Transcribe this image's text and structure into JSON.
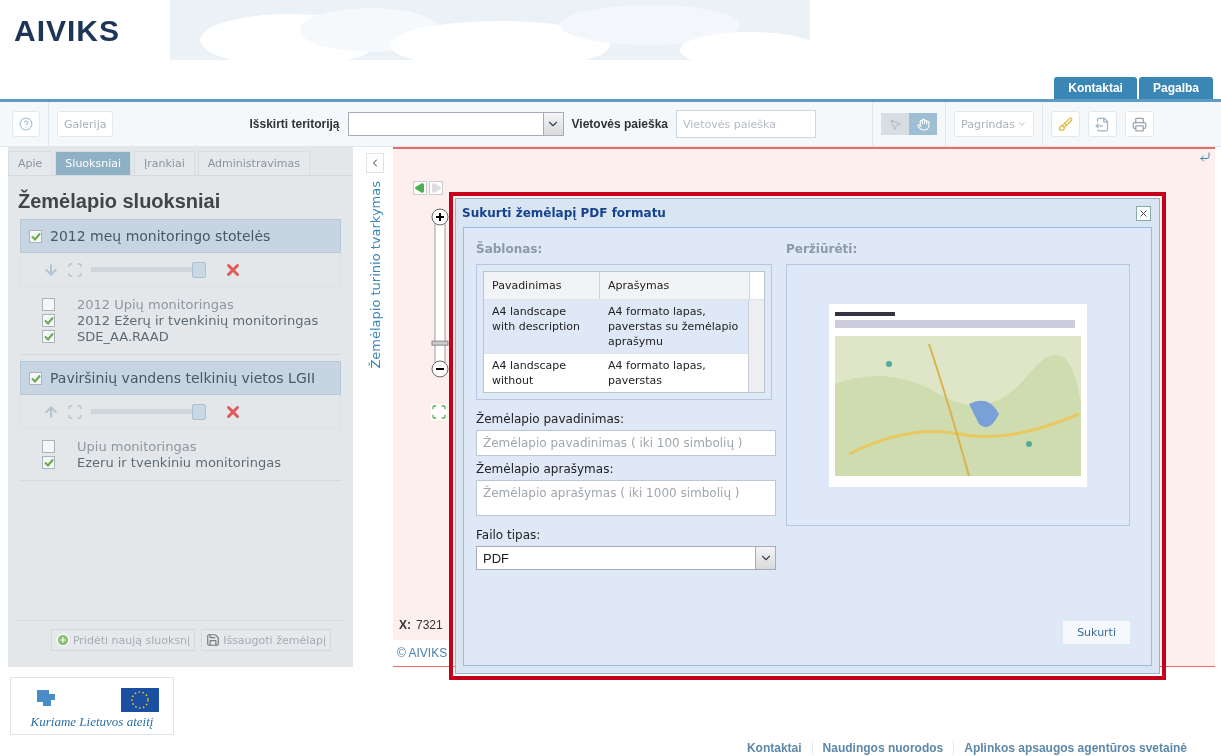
{
  "header": {
    "logo": "AIVIKS",
    "links": [
      "Kontaktai",
      "Pagalba"
    ]
  },
  "toolbar": {
    "gallery_button": "Galerija",
    "territory_label": "Išskirti teritoriją",
    "search_label": "Vietovės paieška",
    "search_field": {
      "placeholder": "Vietovės paieška"
    },
    "tools": [
      {
        "kind": "pointer",
        "selected": false
      },
      {
        "kind": "hand",
        "selected": true
      }
    ],
    "basemap_button": "Pagrindas",
    "actions": [
      {
        "kind": "clear"
      },
      {
        "kind": "export"
      },
      {
        "kind": "print"
      }
    ]
  },
  "side_panel": {
    "tabs": [
      {
        "label": "Apie",
        "selected": false
      },
      {
        "label": "Sluoksniai",
        "selected": true
      },
      {
        "label": "Įrankiai",
        "selected": false
      },
      {
        "label": "Administravimas",
        "selected": false
      }
    ],
    "title": "Žemėlapio sluoksniai",
    "groups": [
      {
        "name": "2012 meų monitoringo stotelės",
        "checked": true,
        "kind": "down",
        "level": 1,
        "layers": [
          {
            "name": "2012 Upių monitoringas",
            "checked": false
          },
          {
            "name": "2012 Ežerų ir tvenkinių monitoringas",
            "checked": true
          },
          {
            "name": "SDE_AA.RAAD",
            "checked": true
          }
        ]
      },
      {
        "name": "Paviršinių vandens telkinių vietos LGII",
        "checked": true,
        "kind": "up",
        "level": 1,
        "layers": [
          {
            "name": "Upiu monitoringas",
            "checked": false
          },
          {
            "name": "Ezeru ir tvenkiniu monitoringas",
            "checked": true
          }
        ]
      }
    ],
    "buttons": [
      {
        "kind": "add",
        "label": "Pridėti naują sluoksnį"
      },
      {
        "kind": "save",
        "label": "Išsaugoti žemėlapį"
      }
    ]
  },
  "collapse_strip": {
    "label": "Žemėlapio turinio tvarkymas"
  },
  "map": {
    "zoom": {
      "level": 0.17
    },
    "coordinates_label": "X:",
    "coordinates_value": "7321",
    "copyright": "© AIVIKS"
  },
  "dialog": {
    "title": "Sukurti žemėlapį PDF formatu",
    "template_label": "Šablonas:",
    "columns": [
      "Pavadinimas",
      "Aprašymas"
    ],
    "rows": [
      {
        "cells": [
          "A4 landscape with description",
          "A4 formato lapas, paverstas su žemėlapio aprašymu"
        ],
        "selected": true
      },
      {
        "cells": [
          "A4 landscape without",
          "A4 formato lapas, paverstas"
        ],
        "selected": false
      }
    ],
    "fields": [
      {
        "kind": "input",
        "label": "Žemėlapio pavadinimas:",
        "placeholder": "Žemėlapio pavadinimas ( iki 100 simbolių )"
      },
      {
        "kind": "textarea",
        "label": "Žemėlapio aprašymas:",
        "placeholder": "Žemėlapio aprašymas ( iki 1000 simbolių )"
      }
    ],
    "file_type": {
      "label": "Failo tipas:",
      "value": "PDF"
    },
    "preview_label": "Peržiūrėti:",
    "preview": {
      "kind": "picture"
    },
    "submit": "Sukurti"
  },
  "footer": {
    "slogan": "Kuriame Lietuvos ateitį",
    "links": [
      "Kontaktai",
      "Naudingos nuorodos",
      "Aplinkos apsaugos agentūros svetainė"
    ]
  }
}
